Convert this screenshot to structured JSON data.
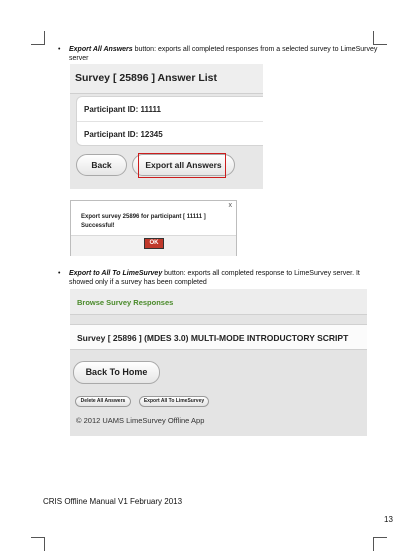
{
  "bullet1": {
    "term": "Export All Answers",
    "text": " button: exports all completed responses from a selected survey to LimeSurvey server"
  },
  "screenshot1": {
    "title": "Survey [ 25896 ] Answer List",
    "rows": [
      "Participant ID: 11111",
      "Participant ID: 12345"
    ],
    "back_label": "Back",
    "export_label": "Export all Answers"
  },
  "dialog": {
    "close": "x",
    "message": "Export survey 25896 for participant [ 11111 ] Successful!",
    "ok_label": "OK"
  },
  "bullet2": {
    "term": "Export to All To LimeSurvey",
    "text": " button: exports all completed response to LimeSurvey server.  It showed only if a survey has been completed"
  },
  "screenshot2": {
    "header": "Browse Survey Responses",
    "survey_item": "Survey [ 25896 ] (MDES 3.0) MULTI-MODE INTRODUCTORY SCRIPT",
    "home_label": "Back To Home",
    "delete_label": "Delete All Answers",
    "export_label": "Export All To LimeSurvey",
    "footer": "© 2012 UAMS LimeSurvey Offline App"
  },
  "footer_text": "CRIS Offline Manual V1 February 2013",
  "page_number": "13"
}
